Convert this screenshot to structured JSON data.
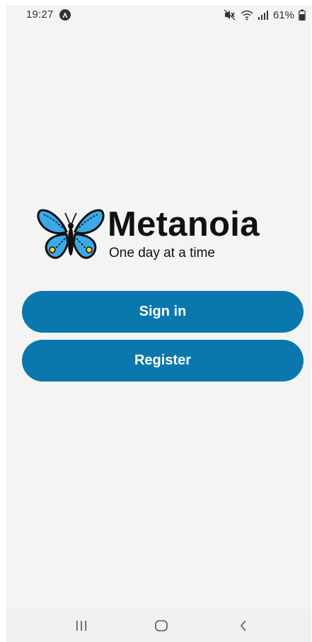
{
  "status_bar": {
    "time": "19:27",
    "battery": "61%",
    "icons": [
      "app-notification-icon",
      "mute-icon",
      "wifi-icon",
      "signal-icon",
      "battery-icon"
    ]
  },
  "logo": {
    "app_name": "Metanoia",
    "tagline": "One day at a time",
    "icon": "butterfly-icon"
  },
  "buttons": {
    "sign_in": "Sign in",
    "register": "Register"
  },
  "nav_bar": {
    "icons": [
      "recents-icon",
      "home-icon",
      "back-icon"
    ]
  },
  "colors": {
    "primary": "#0a78ad",
    "background": "#f4f4f4",
    "butterfly_wing": "#3ba9e6",
    "butterfly_spot": "#f2d338"
  }
}
